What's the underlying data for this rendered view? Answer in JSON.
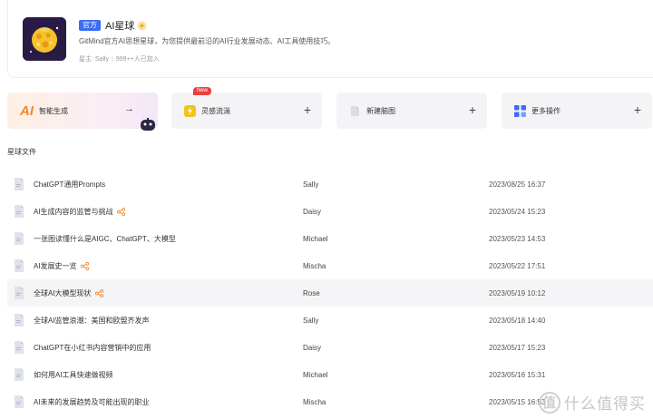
{
  "planet": {
    "badge": "官方",
    "name": "AI星球",
    "description": "GitMind官方AI思想星球，为您提供最前沿的AI行业发展动态、AI工具使用技巧。",
    "owner": "星主: Sally",
    "members": "999++人已加入"
  },
  "actions": {
    "ai": {
      "glyph": "AI",
      "label": "智能生成",
      "arrow": "→"
    },
    "inspire": {
      "label": "灵感流淌",
      "badge": "New",
      "plus": "+"
    },
    "new_mindmap": {
      "label": "新建脑图",
      "plus": "+"
    },
    "more": {
      "label": "更多操作",
      "plus": "+"
    }
  },
  "files": {
    "section_title": "星球文件",
    "rows": [
      {
        "name": "ChatGPT通用Prompts",
        "owner": "Sally",
        "date": "2023/08/25 16:37",
        "shared": false
      },
      {
        "name": "AI生成内容的监管与挑战",
        "owner": "Daisy",
        "date": "2023/05/24 15:23",
        "shared": true
      },
      {
        "name": "一张图读懂什么是AIGC、ChatGPT、大模型",
        "owner": "Michael",
        "date": "2023/05/23 14:53",
        "shared": false
      },
      {
        "name": "AI发展史一览",
        "owner": "Mischa",
        "date": "2023/05/22 17:51",
        "shared": true
      },
      {
        "name": "全球AI大模型现状",
        "owner": "Rose",
        "date": "2023/05/19 10:12",
        "shared": true
      },
      {
        "name": "全球AI监管浪潮：美国和欧盟齐发声",
        "owner": "Sally",
        "date": "2023/05/18 14:40",
        "shared": false
      },
      {
        "name": "ChatGPT在小红书内容营销中的应用",
        "owner": "Daisy",
        "date": "2023/05/17 15:23",
        "shared": false
      },
      {
        "name": "如何用AI工具快速做视频",
        "owner": "Michael",
        "date": "2023/05/16 15:31",
        "shared": false
      },
      {
        "name": "AI未来的发展趋势及可能出现的职业",
        "owner": "Mischa",
        "date": "2023/05/15 16:53",
        "shared": false
      }
    ]
  },
  "watermark": {
    "logo": "值",
    "text": "什么值得买"
  },
  "colors": {
    "accent": "#3a6cf4",
    "ai_orange": "#f08a2e",
    "share_orange": "#f28a2c",
    "new_red": "#ee3f3f"
  }
}
